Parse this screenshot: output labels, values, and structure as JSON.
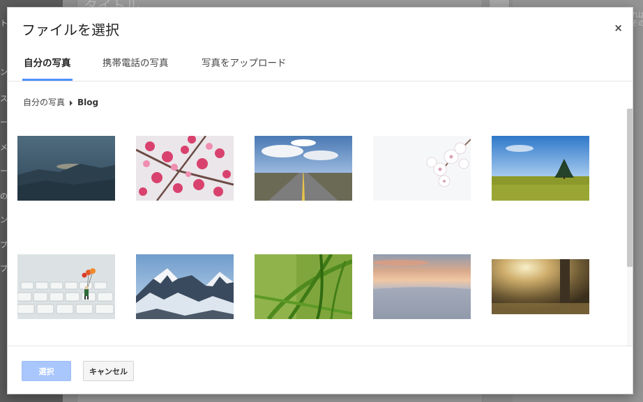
{
  "background": {
    "title_placeholder": "タイトル",
    "sidebar_items": [
      "ト",
      "ン",
      "ス",
      "ー",
      "メ",
      "ー",
      "の",
      "ン",
      "プ",
      "プ"
    ],
    "right_text": [
      "れば",
      "その"
    ]
  },
  "dialog": {
    "title": "ファイルを選択",
    "close_label": "×",
    "tabs": [
      {
        "label": "自分の写真",
        "active": true
      },
      {
        "label": "携帯電話の写真",
        "active": false
      },
      {
        "label": "写真をアップロード",
        "active": false
      }
    ],
    "breadcrumb": {
      "root": "自分の写真",
      "current": "Blog"
    },
    "photos": [
      {
        "subject": "misty-mountains"
      },
      {
        "subject": "pink-blossoms"
      },
      {
        "subject": "open-road"
      },
      {
        "subject": "white-cherry-blossom"
      },
      {
        "subject": "green-field-tree"
      },
      {
        "subject": "keyboard-figure-balloons"
      },
      {
        "subject": "snowy-mountains"
      },
      {
        "subject": "green-grass"
      },
      {
        "subject": "sunset-clouds"
      },
      {
        "subject": "sunlit-forest"
      }
    ],
    "footer": {
      "select_label": "選択",
      "cancel_label": "キャンセル"
    }
  }
}
